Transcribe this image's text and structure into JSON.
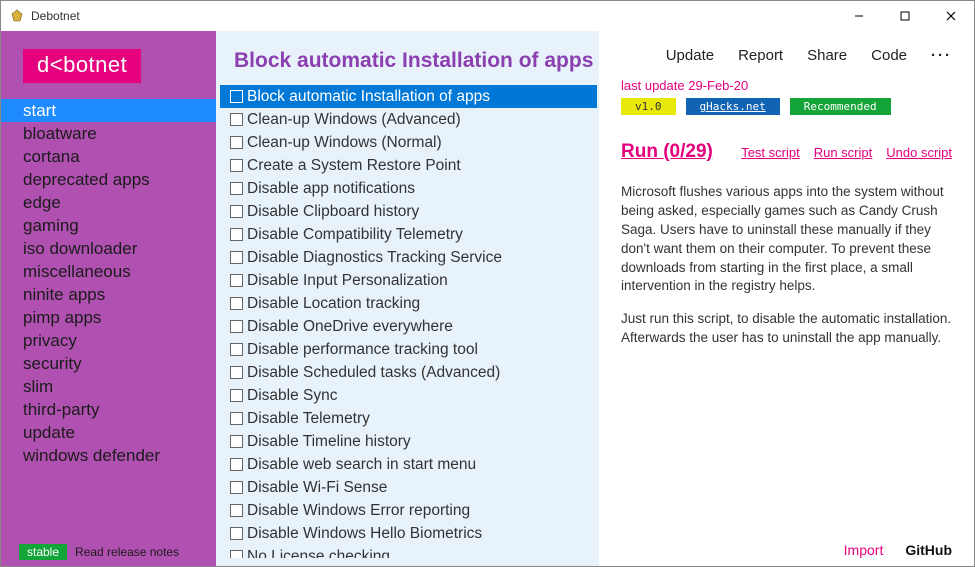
{
  "window": {
    "title": "Debotnet"
  },
  "logo": "d<botnet",
  "sidebar": {
    "items": [
      "start",
      "bloatware",
      "cortana",
      "deprecated apps",
      "edge",
      "gaming",
      "iso downloader",
      "miscellaneous",
      "ninite apps",
      "pimp apps",
      "privacy",
      "security",
      "slim",
      "third-party",
      "update",
      "windows defender"
    ],
    "selected_index": 0,
    "stable_badge": "stable",
    "release_link": "Read release notes"
  },
  "center": {
    "title": "Block automatic Installation of apps",
    "selected_index": 0,
    "items": [
      "Block automatic Installation of apps",
      "Clean-up Windows (Advanced)",
      "Clean-up Windows (Normal)",
      "Create a System Restore Point",
      "Disable app notifications",
      "Disable Clipboard history",
      "Disable Compatibility Telemetry",
      "Disable Diagnostics Tracking Service",
      "Disable Input Personalization",
      "Disable Location tracking",
      "Disable OneDrive everywhere",
      "Disable performance tracking tool",
      "Disable Scheduled tasks (Advanced)",
      "Disable Sync",
      "Disable Telemetry",
      "Disable Timeline history",
      "Disable web search in start menu",
      "Disable Wi-Fi Sense",
      "Disable Windows Error reporting",
      "Disable Windows Hello Biometrics",
      "No License checking"
    ]
  },
  "right": {
    "top_links": [
      "Update",
      "Report",
      "Share",
      "Code"
    ],
    "more": "···",
    "last_update": "last update 29-Feb-20",
    "version_badge": "v1.0",
    "source_badge": "gHacks.net",
    "recommended_badge": "Recommended",
    "run_label": "Run (0/29)",
    "test_script": "Test script",
    "run_script": "Run script",
    "undo_script": "Undo script",
    "desc_p1": "Microsoft flushes various apps into the system without being asked, especially games such as Candy Crush Saga. Users have to uninstall these manually if they don't want them on their computer. To prevent these downloads from starting in the first place, a small intervention in the registry helps.",
    "desc_p2": "Just run this script, to disable the automatic installation. Afterwards the user has to uninstall the app manually.",
    "import": "Import",
    "github": "GitHub"
  }
}
